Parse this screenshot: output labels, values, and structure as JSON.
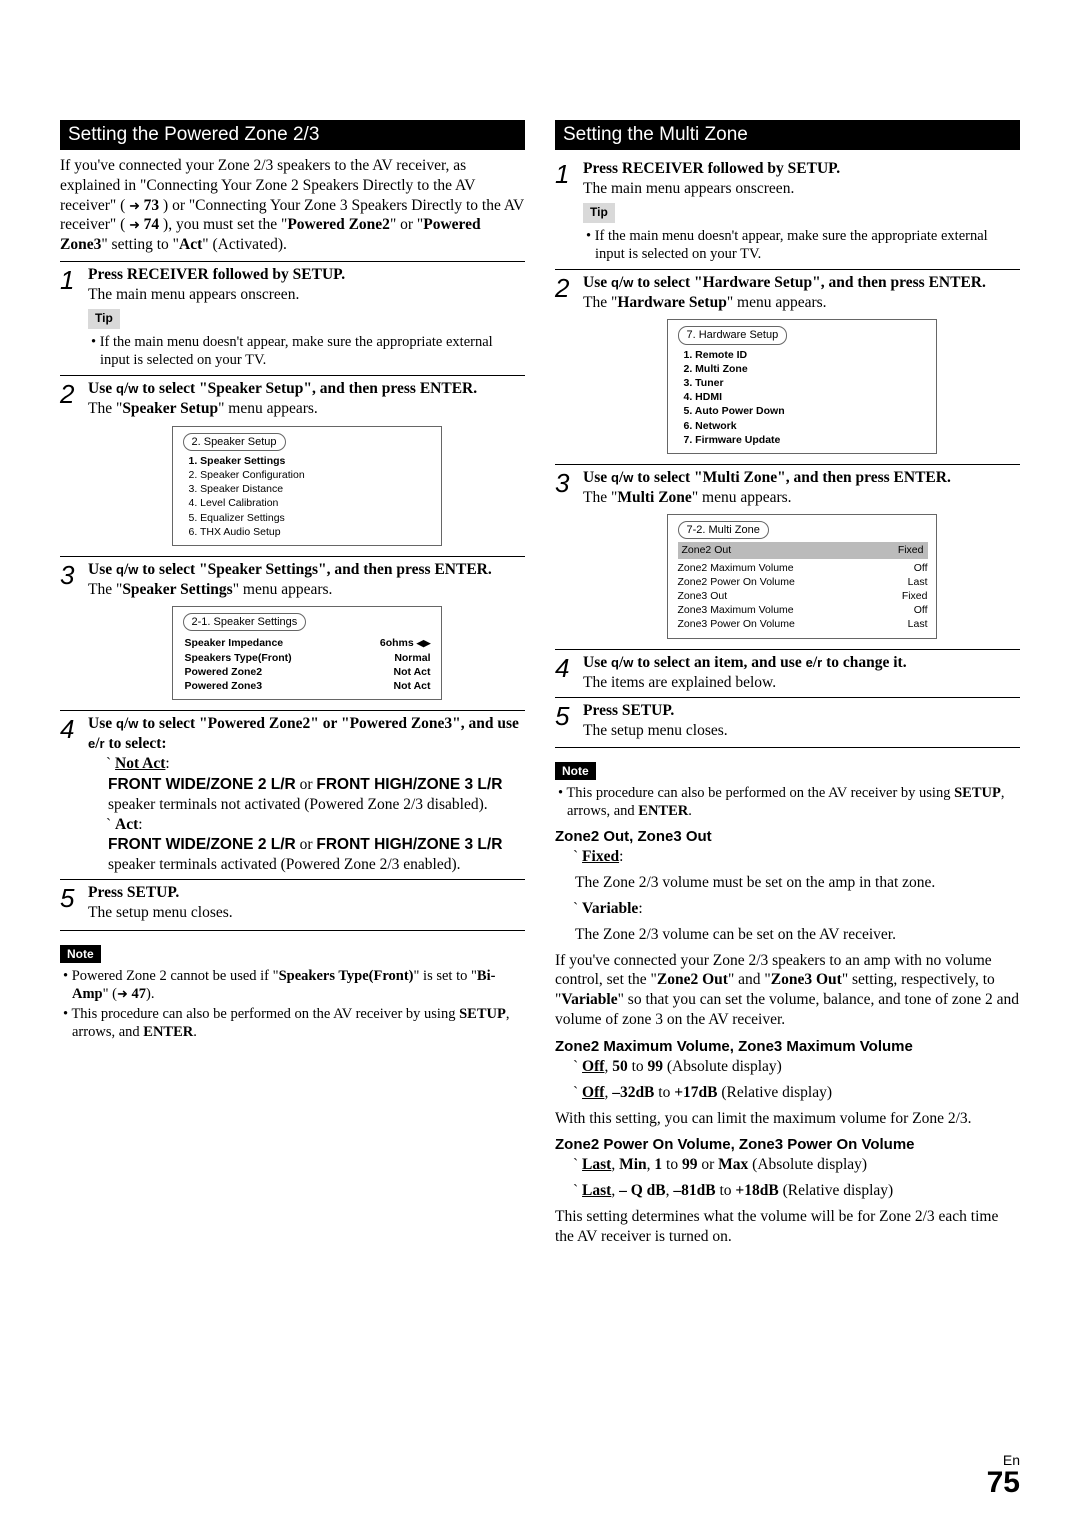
{
  "left": {
    "header": "Setting the Powered Zone 2/3",
    "intro1": "If you've connected your Zone 2/3 speakers to the AV receiver, as explained in \"Connecting Your Zone 2 Speakers Directly to the AV receiver\" (",
    "introRef1": "73",
    "intro2": ") or \"Connecting Your Zone 3 Speakers Directly to the AV receiver\" (",
    "introRef2": "74",
    "intro3": "), you must set the \"",
    "intro4": "Powered Zone2",
    "intro5": "\" or \"",
    "intro6": "Powered Zone3",
    "intro7": "\" setting to \"",
    "intro8": "Act",
    "intro9": "\" (Activated).",
    "s1": {
      "n": "1",
      "l1": "Press RECEIVER followed by SETUP.",
      "l2": "The main menu appears onscreen.",
      "tip": "Tip",
      "tipText": "If the main menu doesn't appear, make sure the appropriate external input is selected on your TV."
    },
    "s2": {
      "n": "2",
      "l1a": "Use ",
      "l1b": "q",
      "l1c": "/",
      "l1d": "w",
      "l1e": " to select \"Speaker Setup\", and then press ENTER.",
      "l2a": "The \"",
      "l2b": "Speaker Setup",
      "l2c": "\" menu appears.",
      "menuTitle": "2.   Speaker Setup",
      "items": [
        "1.   Speaker Settings",
        "2.   Speaker Configuration",
        "3.   Speaker Distance",
        "4.   Level Calibration",
        "5.   Equalizer Settings",
        "6.   THX Audio Setup"
      ]
    },
    "s3": {
      "n": "3",
      "l1a": "Use ",
      "l1e": " to select \"Speaker Settings\", and then press ENTER.",
      "l2a": "The \"",
      "l2b": "Speaker Settings",
      "l2c": "\" menu appears.",
      "menuTitle": "2-1.   Speaker Settings",
      "rows": [
        [
          "Speaker Impedance",
          "6ohms"
        ],
        [
          "Speakers Type(Front)",
          "Normal"
        ],
        [
          "Powered Zone2",
          "Not Act"
        ],
        [
          "Powered Zone3",
          "Not Act"
        ]
      ]
    },
    "s4": {
      "n": "4",
      "l1a": "Use ",
      "l1e": " to select \"Powered Zone2\" or \"Powered Zone3\", and use ",
      "l1f": "e",
      "l1g": "/",
      "l1h": "r",
      "l1i": " to select:",
      "not": "Not Act",
      "notColon": ":",
      "notLine1a": "FRONT WIDE/ZONE 2 L/R",
      "notLine1b": " or ",
      "notLine1c": "FRONT HIGH/ZONE 3 L/R",
      "notLine2": " speaker terminals not activated (Powered Zone 2/3 disabled).",
      "act": "Act",
      "actLine1a": "FRONT WIDE/ZONE 2 L/R",
      "actLine1b": " or ",
      "actLine1c": "FRONT HIGH/ZONE 3 L/R",
      "actLine2": " speaker terminals activated (Powered Zone 2/3 enabled)."
    },
    "s5": {
      "n": "5",
      "l1": "Press SETUP.",
      "l2": "The setup menu closes."
    },
    "note": "Note",
    "noteB1a": "Powered Zone 2 cannot be used if \"",
    "noteB1b": "Speakers Type(Front)",
    "noteB1c": "\" is set to \"",
    "noteB1d": "Bi-Amp",
    "noteB1e": "\" (",
    "noteB1ref": "47",
    "noteB1f": ").",
    "noteB2a": "This procedure can also be performed on the AV receiver by using ",
    "noteB2b": "SETUP",
    "noteB2c": ", arrows, and ",
    "noteB2d": "ENTER",
    "noteB2e": "."
  },
  "right": {
    "header": "Setting the Multi Zone",
    "s1": {
      "n": "1",
      "l1": "Press RECEIVER followed by SETUP.",
      "l2": "The main menu appears onscreen.",
      "tip": "Tip",
      "tipText": "If the main menu doesn't appear, make sure the appropriate external input is selected on your TV."
    },
    "s2": {
      "n": "2",
      "l1e": " to select \"Hardware Setup\", and then press ENTER.",
      "l2a": "The \"",
      "l2b": "Hardware Setup",
      "l2c": "\" menu appears.",
      "menuTitle": "7.   Hardware Setup",
      "items": [
        "1.   Remote ID",
        "2.   Multi Zone",
        "3.   Tuner",
        "4.   HDMI",
        "5.   Auto Power Down",
        "6.   Network",
        "7.   Firmware Update"
      ]
    },
    "s3": {
      "n": "3",
      "l1e": " to select \"Multi Zone\", and then press ENTER.",
      "l2a": "The \"",
      "l2b": "Multi Zone",
      "l2c": "\" menu appears.",
      "menuTitle": "7-2. Multi Zone",
      "rows": [
        [
          "Zone2 Out",
          "Fixed"
        ],
        [
          "Zone2 Maximum Volume",
          "Off"
        ],
        [
          "Zone2 Power On Volume",
          "Last"
        ],
        [
          "Zone3 Out",
          "Fixed"
        ],
        [
          "Zone3 Maximum Volume",
          "Off"
        ],
        [
          "Zone3 Power On Volume",
          "Last"
        ]
      ]
    },
    "s4": {
      "n": "4",
      "l1e": " to select an item, and use ",
      "l1i": " to change it.",
      "l2": "The items are explained below."
    },
    "s5": {
      "n": "5",
      "l1": "Press SETUP.",
      "l2": "The setup menu closes."
    },
    "note": "Note",
    "noteB1a": "This procedure can also be performed on the AV receiver by using ",
    "noteB1b": "SETUP",
    "noteB1c": ", arrows, and ",
    "noteB1d": "ENTER",
    "noteB1e": ".",
    "h1": "Zone2 Out, Zone3 Out",
    "fixed": "Fixed",
    "fixedColon": ":",
    "fixedText": "The Zone 2/3 volume must be set on the amp in that zone.",
    "variable": "Variable",
    "variableColon": ":",
    "variableText": "The Zone 2/3 volume can be set on the AV receiver.",
    "p1a": "If you've connected your Zone 2/3 speakers to an amp with no volume control, set the \"",
    "p1b": "Zone2 Out",
    "p1c": "\" and \"",
    "p1d": "Zone3 Out",
    "p1e": "\" setting, respectively, to \"",
    "p1f": "Variable",
    "p1g": "\" so that you can set the volume, balance, and tone of zone 2 and volume of zone 3 on the AV receiver.",
    "h2": "Zone2 Maximum Volume, Zone3 Maximum Volume",
    "mv1a": "Off",
    "mv1b": ", ",
    "mv1c": "50",
    "mv1d": " to ",
    "mv1e": "99",
    "mv1f": " (Absolute display)",
    "mv2a": "Off",
    "mv2b": ", ",
    "mv2c": "–32dB",
    "mv2d": " to ",
    "mv2e": "+17dB",
    "mv2f": " (Relative display)",
    "mvText": "With this setting, you can limit the maximum volume for Zone 2/3.",
    "h3": "Zone2 Power On Volume, Zone3 Power On Volume",
    "pv1a": "Last",
    "pv1b": ", ",
    "pv1c": "Min",
    "pv1d": ", ",
    "pv1e": "1",
    "pv1f": " to ",
    "pv1g": "99",
    "pv1h": " or ",
    "pv1i": "Max",
    "pv1j": " (Absolute display)",
    "pv2a": "Last",
    "pv2b": ", ",
    "pv2c": "– Q dB",
    "pv2d": ", ",
    "pv2e": "–81dB",
    "pv2f": " to ",
    "pv2g": "+18dB",
    "pv2h": " (Relative display)",
    "pvText": "This setting determines what the volume will be for Zone 2/3 each time the AV receiver is turned on."
  },
  "footer": {
    "en": "En",
    "n": "75"
  }
}
